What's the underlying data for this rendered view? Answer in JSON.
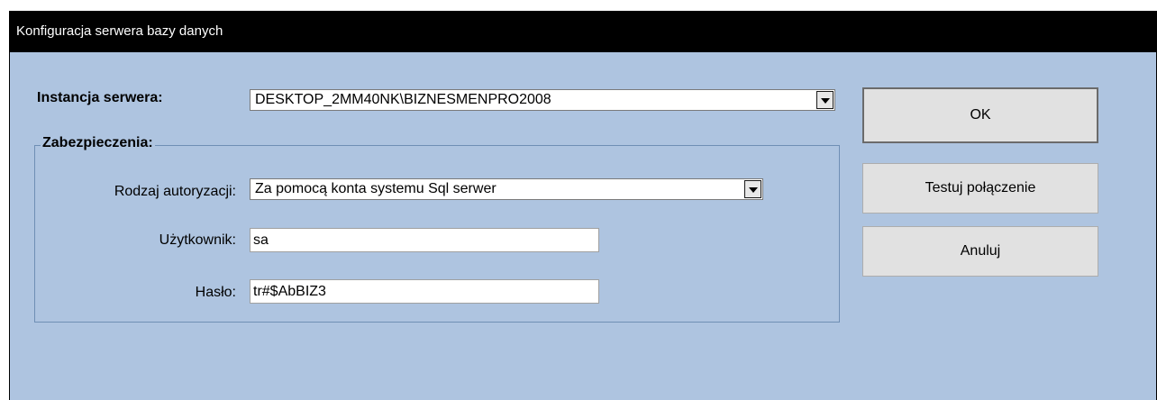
{
  "window": {
    "title": "Konfiguracja serwera bazy danych"
  },
  "server": {
    "label": "Instancja serwera:",
    "value": "DESKTOP_2MM40NK\\BIZNESMENPRO2008"
  },
  "security": {
    "legend": "Zabezpieczenia:",
    "auth_label": "Rodzaj autoryzacji:",
    "auth_value": "Za pomocą konta systemu Sql serwer",
    "user_label": "Użytkownik:",
    "user_value": "sa",
    "password_label": "Hasło:",
    "password_value": "tr#$AbBIZ3"
  },
  "buttons": {
    "ok": "OK",
    "test": "Testuj połączenie",
    "cancel": "Anuluj"
  },
  "icons": {
    "dropdown": "chevron-down-icon"
  },
  "colors": {
    "titlebar": "#000000",
    "client_bg": "#aec4e0",
    "button_bg": "#e1e1e1",
    "group_border": "#6f8fb5"
  }
}
